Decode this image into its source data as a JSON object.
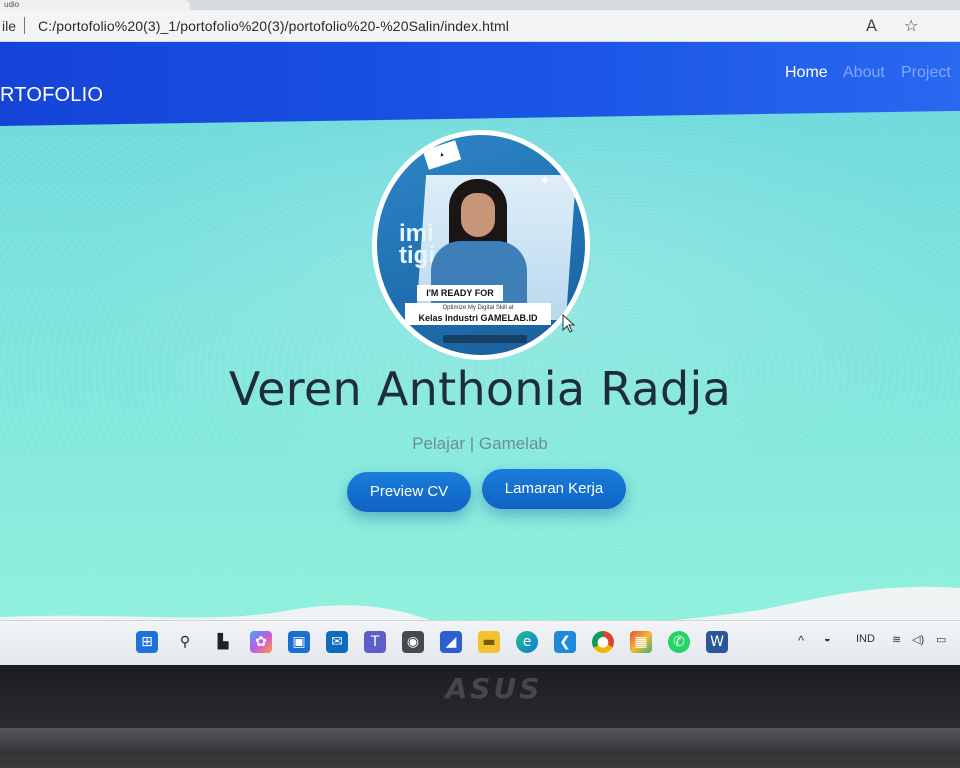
{
  "browser": {
    "tab_fragment": "udio",
    "address_prefix": "ile",
    "url": "C:/portofolio%20(3)_1/portofolio%20(3)/portofolio%20-%20Salin/index.html",
    "read_aloud_icon": "read-aloud-icon",
    "favorite_icon": "star-icon"
  },
  "site": {
    "brand": "RTOFOLIO",
    "nav": {
      "home": "Home",
      "about": "About",
      "project": "Project"
    },
    "profile": {
      "badge_line1": "I'M READY FOR",
      "badge_line2_small": "Optimize My Digital Skill at",
      "badge_line2": "Kelas Industri GAMELAB.ID",
      "bg_text": "imi\ntigi"
    },
    "name": "Veren Anthonia Radja",
    "subtitle": "Pelajar | Gamelab",
    "buttons": {
      "cv": "Preview CV",
      "lamaran": "Lamaran Kerja"
    }
  },
  "taskbar": {
    "icons": [
      "windows-start-icon",
      "search-icon",
      "task-view-icon",
      "copilot-icon",
      "store-icon",
      "outlook-icon",
      "teams-icon",
      "camera-icon",
      "editor-icon",
      "file-explorer-icon",
      "edge-icon",
      "vscode-icon",
      "chrome-icon",
      "photos-icon",
      "whatsapp-icon",
      "word-icon"
    ],
    "tray": {
      "language": "IND"
    }
  },
  "laptop": {
    "brand": "ASUS"
  },
  "colors": {
    "navbar": "#1b56e6",
    "button": "#1372d2",
    "title": "#1f2d3a",
    "background": "#7be3dc"
  }
}
